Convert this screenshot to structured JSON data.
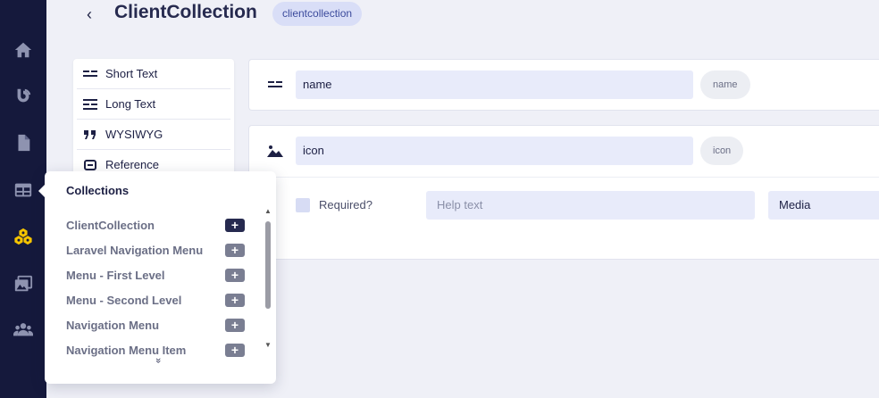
{
  "header": {
    "back_label": "‹",
    "title": "ClientCollection",
    "slug": "clientcollection"
  },
  "rail": {
    "icons": [
      "home-icon",
      "blog-icon",
      "document-icon",
      "table-icon",
      "cubes-icon",
      "media-icon",
      "users-icon"
    ],
    "accent": "#f5c400"
  },
  "field_types": [
    {
      "label": "Short Text",
      "icon": "short-text-icon"
    },
    {
      "label": "Long Text",
      "icon": "long-text-icon"
    },
    {
      "label": "WYSIWYG",
      "icon": "quote-icon"
    },
    {
      "label": "Reference",
      "icon": "reference-icon"
    }
  ],
  "fields": [
    {
      "name": "name",
      "key": "name",
      "icon": "short-text-icon"
    },
    {
      "name": "icon",
      "key": "icon",
      "icon": "image-icon"
    }
  ],
  "field_options": {
    "required_label": "Required?",
    "help_placeholder": "Help text",
    "type_value": "Media"
  },
  "collections_popup": {
    "title": "Collections",
    "items": [
      {
        "label": "ClientCollection"
      },
      {
        "label": "Laravel Navigation Menu"
      },
      {
        "label": "Menu - First Level"
      },
      {
        "label": "Menu - Second Level"
      },
      {
        "label": "Navigation Menu"
      },
      {
        "label": "Navigation Menu Item"
      }
    ],
    "more_label": "»"
  }
}
